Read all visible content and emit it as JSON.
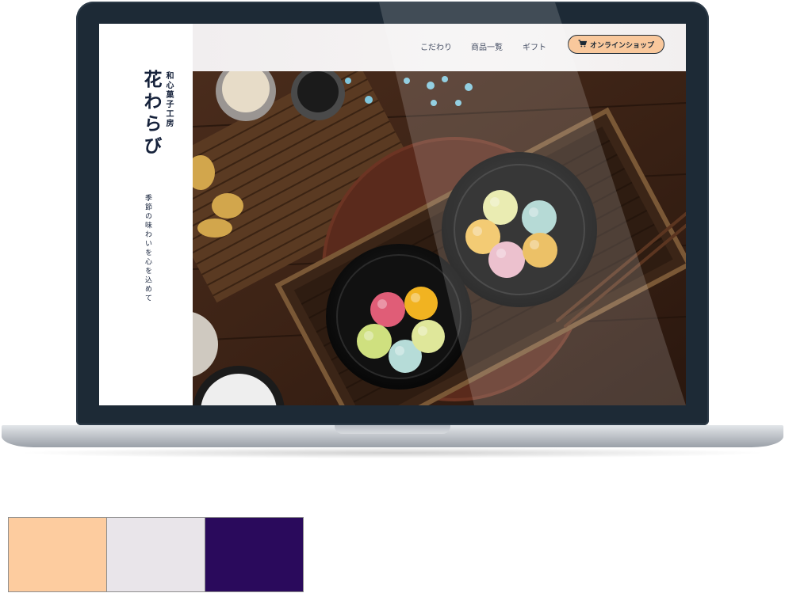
{
  "site": {
    "brand": {
      "name": "花わらび",
      "subtitle": "和心菓子工房",
      "tagline": "季節の味わいを心を込めて"
    },
    "nav": {
      "items": [
        {
          "label": "こだわり"
        },
        {
          "label": "商品一覧"
        },
        {
          "label": "ギフト"
        }
      ],
      "shop_button": {
        "label": "オンラインショップ",
        "icon": "shopping-cart-icon"
      }
    },
    "hero": {
      "subject": "wagashi-dango-photo",
      "mochi_colors": [
        "#e6e9a4",
        "#a9d3cf",
        "#f1c15a",
        "#e9b6c5",
        "#e9b54a",
        "#e05d77",
        "#f1b321",
        "#cfe07f",
        "#b6dcd8",
        "#dfe79a"
      ]
    }
  },
  "palette": {
    "swatches": [
      {
        "name": "peach",
        "color": "#fdcc9f"
      },
      {
        "name": "lavender-gray",
        "color": "#e9e5ea"
      },
      {
        "name": "deep-purple",
        "color": "#2a0a5c"
      }
    ]
  }
}
